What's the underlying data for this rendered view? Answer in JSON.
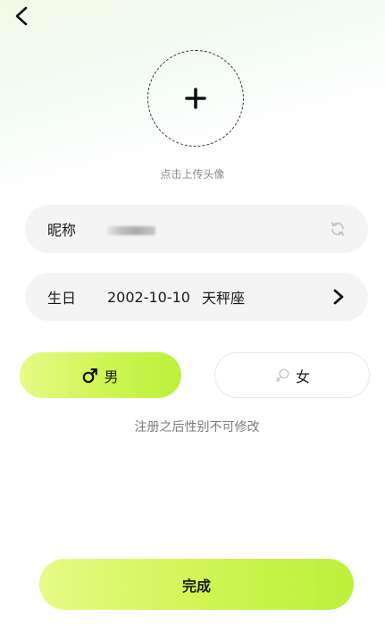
{
  "avatar": {
    "hint": "点击上传头像"
  },
  "nickname": {
    "label": "昵称",
    "value": ""
  },
  "birthday": {
    "label": "生日",
    "date": "2002-10-10",
    "zodiac": "天秤座"
  },
  "gender": {
    "male_label": "男",
    "female_label": "女",
    "selected": "male",
    "note": "注册之后性别不可修改"
  },
  "done_label": "完成",
  "colors": {
    "accent_start": "#e7fa86",
    "accent_end": "#bdf03b"
  },
  "icons": [
    "back-arrow-icon",
    "plus-icon",
    "refresh-icon",
    "chevron-right-icon",
    "male-icon",
    "female-icon"
  ]
}
